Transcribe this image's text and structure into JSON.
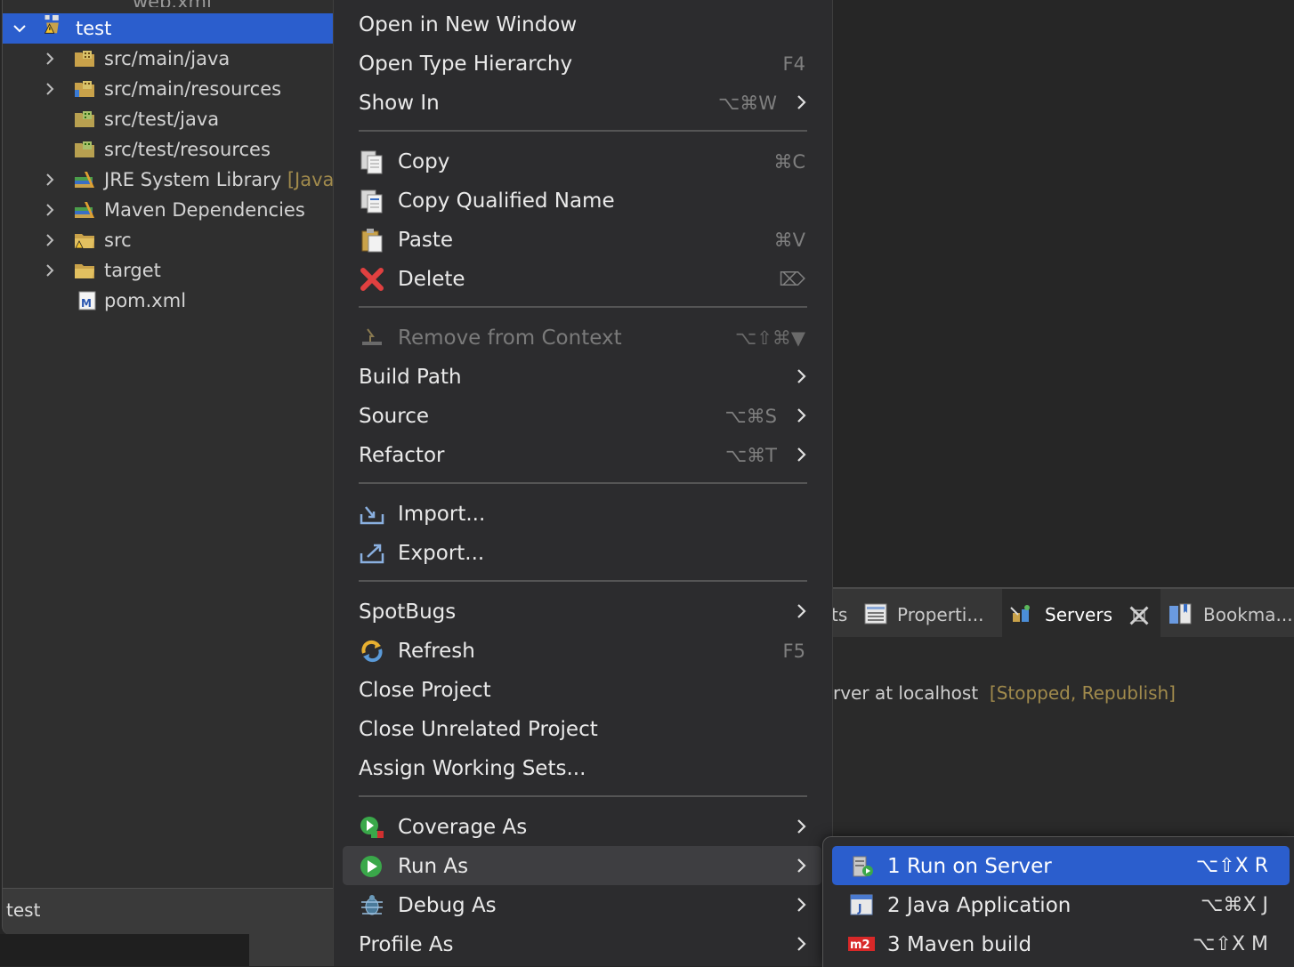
{
  "explorer": {
    "partial_top": "web.xml",
    "project": "test",
    "items": [
      {
        "label": "src/main/java",
        "expandable": true,
        "icon": "package-folder-icon"
      },
      {
        "label": "src/main/resources",
        "expandable": true,
        "icon": "package-folder-icon"
      },
      {
        "label": "src/test/java",
        "expandable": false,
        "icon": "package-folder-icon"
      },
      {
        "label": "src/test/resources",
        "expandable": false,
        "icon": "package-folder-icon"
      },
      {
        "label": "JRE System Library",
        "decoration": "[Java",
        "expandable": true,
        "icon": "library-icon"
      },
      {
        "label": "Maven Dependencies",
        "expandable": true,
        "icon": "library-icon"
      },
      {
        "label": "src",
        "expandable": true,
        "icon": "folder-icon"
      },
      {
        "label": "target",
        "expandable": true,
        "icon": "folder-icon"
      },
      {
        "label": "pom.xml",
        "expandable": false,
        "icon": "maven-file-icon"
      }
    ],
    "status_text": "test"
  },
  "servers_view": {
    "tabs": {
      "partial": "ts",
      "properties": "Properti...",
      "servers": "Servers",
      "bookmarks": "Bookma..."
    },
    "server_name_partial": "rver at localhost",
    "server_state": "[Stopped, Republish]"
  },
  "context_menu": {
    "open_new_window": "Open in New Window",
    "open_type_hierarchy": "Open Type Hierarchy",
    "open_type_hierarchy_sc": "F4",
    "show_in": "Show In",
    "show_in_sc": "⌥⌘W",
    "copy": "Copy",
    "copy_sc": "⌘C",
    "copy_qualified": "Copy Qualified Name",
    "paste": "Paste",
    "paste_sc": "⌘V",
    "delete": "Delete",
    "delete_sc": "⌦",
    "remove_context": "Remove from Context",
    "remove_context_sc": "⌥⇧⌘▼",
    "build_path": "Build Path",
    "source": "Source",
    "source_sc": "⌥⌘S",
    "refactor": "Refactor",
    "refactor_sc": "⌥⌘T",
    "import": "Import...",
    "export": "Export...",
    "spotbugs": "SpotBugs",
    "refresh": "Refresh",
    "refresh_sc": "F5",
    "close_project": "Close Project",
    "close_unrelated": "Close Unrelated Project",
    "assign_working_sets": "Assign Working Sets...",
    "coverage_as": "Coverage As",
    "run_as": "Run As",
    "debug_as": "Debug As",
    "profile_as": "Profile As"
  },
  "run_as_submenu": {
    "run_on_server": "1 Run on Server",
    "run_on_server_sc": "⌥⇧X R",
    "java_application": "2 Java Application",
    "java_application_sc": "⌥⌘X J",
    "maven_build": "3 Maven build",
    "maven_build_sc": "⌥⇧X M"
  },
  "colors": {
    "selection": "#2b5ecd",
    "menu_bg": "#2c2c2e",
    "decoration": "#a08a4c"
  }
}
